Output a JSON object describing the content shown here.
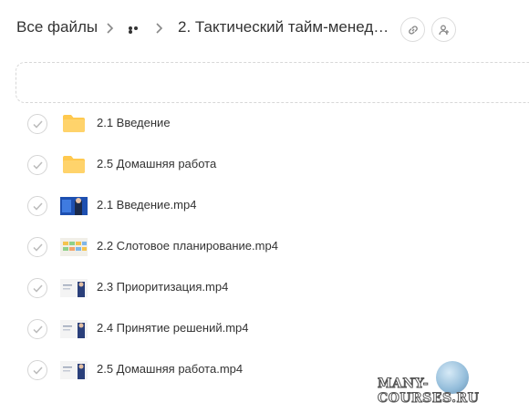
{
  "breadcrumb": {
    "root": "Все файлы",
    "current": "2. Тактический тайм-менедж..."
  },
  "files": [
    {
      "name": "2.1 Введение",
      "type": "folder"
    },
    {
      "name": "2.5 Домашняя работа",
      "type": "folder"
    },
    {
      "name": "2.1 Введение.mp4",
      "type": "video",
      "thumb": "blue"
    },
    {
      "name": "2.2 Слотовое планирование.mp4",
      "type": "video",
      "thumb": "grid"
    },
    {
      "name": "2.3 Приоритизация.mp4",
      "type": "video",
      "thumb": "slide"
    },
    {
      "name": "2.4 Принятие решений.mp4",
      "type": "video",
      "thumb": "slide"
    },
    {
      "name": "2.5 Домашняя работа.mp4",
      "type": "video",
      "thumb": "slide"
    }
  ],
  "watermark": {
    "text": "MANY-COURSES.RU"
  },
  "colors": {
    "folder": "#ffcc5c",
    "border": "#d7d7d7",
    "text": "#333333"
  },
  "icons": {
    "header_buttons": [
      "link-icon",
      "share-users-icon"
    ],
    "row_check": "check-icon"
  }
}
